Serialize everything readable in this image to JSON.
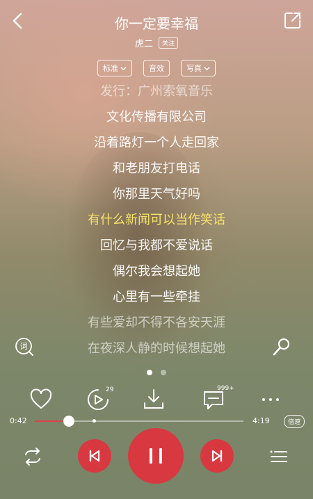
{
  "header": {
    "title": "你一定要幸福",
    "artist": "虎二",
    "follow_label": "关注"
  },
  "chips": [
    {
      "label": "标准",
      "has_dropdown": true
    },
    {
      "label": "音效",
      "has_dropdown": false
    },
    {
      "label": "写真",
      "has_dropdown": true
    }
  ],
  "lyrics": [
    {
      "text": "发行：广州索氧音乐",
      "state": "dim"
    },
    {
      "text": "文化传播有限公司",
      "state": "normal"
    },
    {
      "text": "沿着路灯一个人走回家",
      "state": "normal"
    },
    {
      "text": "和老朋友打电话",
      "state": "normal"
    },
    {
      "text": "你那里天气好吗",
      "state": "normal"
    },
    {
      "text": "有什么新闻可以当作笑话",
      "state": "active"
    },
    {
      "text": "回忆与我都不爱说话",
      "state": "normal"
    },
    {
      "text": "偶尔我会想起她",
      "state": "normal"
    },
    {
      "text": "心里有一些牵挂",
      "state": "normal"
    },
    {
      "text": "有些爱却不得不各安天涯",
      "state": "dim"
    },
    {
      "text": "在夜深人静的时候想起她",
      "state": "dim"
    }
  ],
  "lyric_icon_label": "词",
  "pager": {
    "count": 2,
    "active": 0
  },
  "actions": {
    "like": "heart-icon",
    "play_video_count": "29",
    "download": "download-icon",
    "comments_count": "999+",
    "more": "more-icon"
  },
  "progress": {
    "current": "0:42",
    "total": "4:19",
    "fraction": 0.162,
    "buffered_fraction": 0.275,
    "speed_label": "倍速"
  },
  "colors": {
    "accent": "#d8383f",
    "active_lyric": "#f6e36a"
  }
}
